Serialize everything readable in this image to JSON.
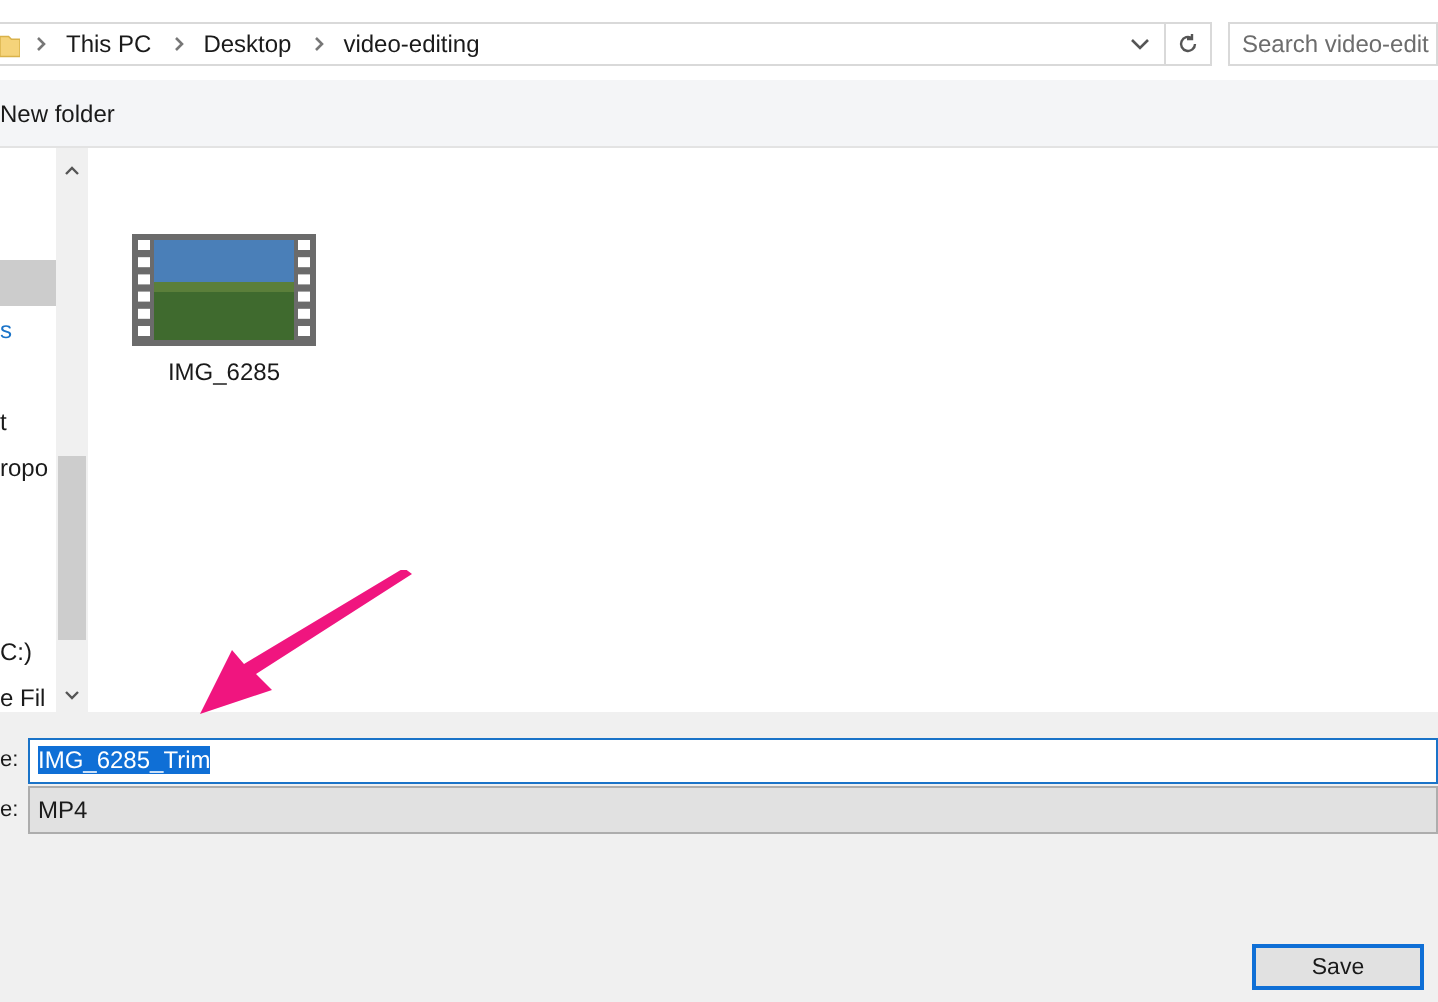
{
  "address_bar": {
    "path": [
      "This PC",
      "Desktop",
      "video-editing"
    ]
  },
  "search": {
    "placeholder": "Search video-edit"
  },
  "toolbar": {
    "new_folder": "New folder"
  },
  "sidebar": {
    "items": [
      {
        "kind": "item",
        "selected": true
      },
      {
        "kind": "link",
        "label": "s",
        "selected": false
      },
      {
        "kind": "gap"
      },
      {
        "kind": "item",
        "label": "t",
        "selected": false
      },
      {
        "kind": "item",
        "label": "ropo",
        "selected": false
      },
      {
        "kind": "gap"
      },
      {
        "kind": "gap"
      },
      {
        "kind": "gap"
      },
      {
        "kind": "item",
        "label": "C:)",
        "selected": false
      },
      {
        "kind": "item",
        "label": "e Fil",
        "selected": false
      }
    ]
  },
  "files": [
    {
      "name": "IMG_6285",
      "kind": "video"
    }
  ],
  "file_name": {
    "label": "e:",
    "value": "IMG_6285_Trim",
    "selected": true
  },
  "file_type": {
    "label": "e:",
    "value": "MP4"
  },
  "buttons": [
    "Save"
  ]
}
